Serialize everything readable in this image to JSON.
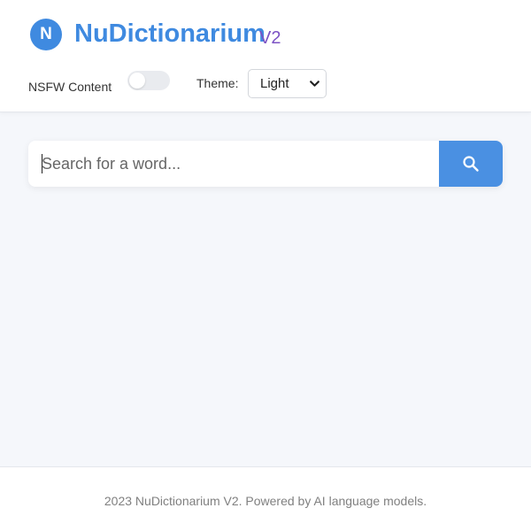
{
  "header": {
    "logo_letter": "N",
    "title": "NuDictionarium",
    "version": "V2",
    "nsfw_label": "NSFW Content",
    "nsfw_enabled": false,
    "theme_label": "Theme:",
    "theme_selected": "Light"
  },
  "search": {
    "placeholder": "Search for a word...",
    "value": "",
    "button_icon": "search-icon"
  },
  "footer": {
    "text": "2023 NuDictionarium V2. Powered by AI language models."
  },
  "colors": {
    "brand": "#3f8ae0",
    "version": "#7c52c4",
    "search_button": "#4a90e2",
    "background": "#f5f7fb"
  }
}
